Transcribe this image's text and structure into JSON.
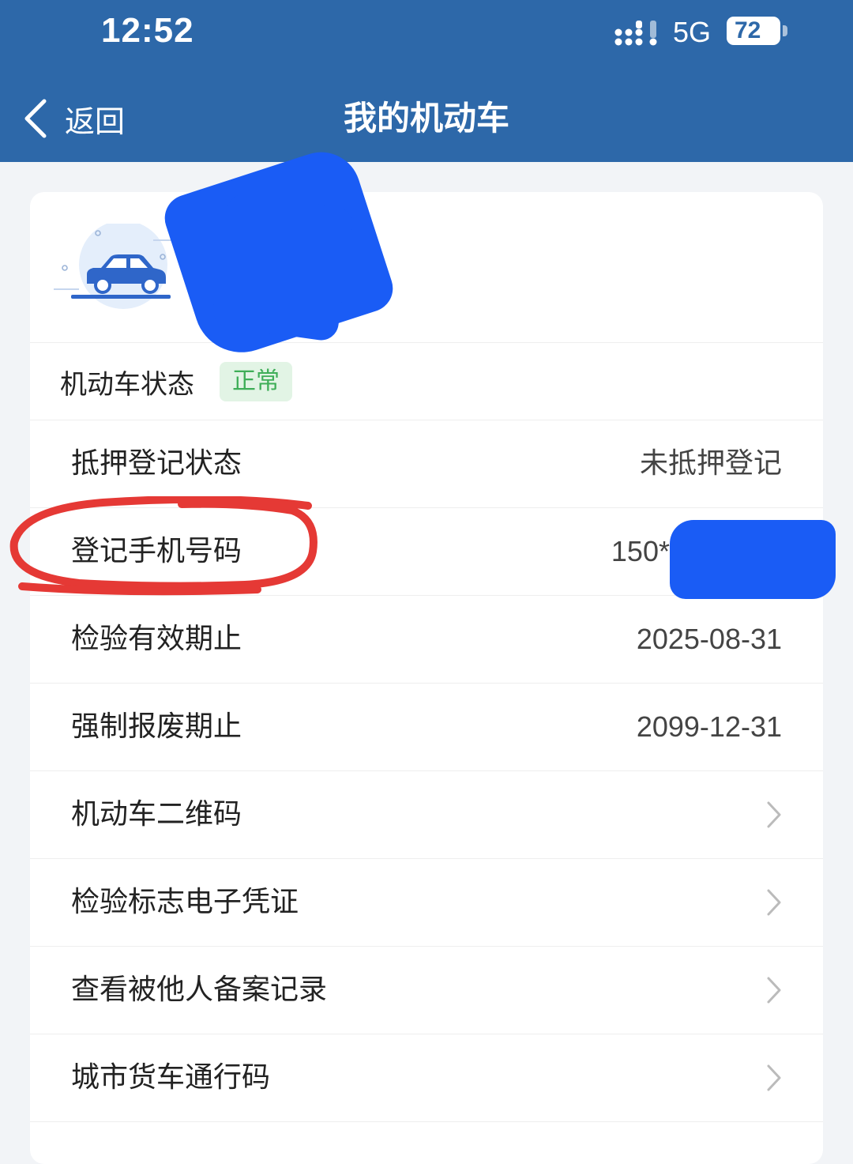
{
  "status_bar": {
    "time": "12:52",
    "network": "5G",
    "battery": "72"
  },
  "nav": {
    "back_label": "返回",
    "title": "我的机动车"
  },
  "vehicle": {
    "status_label": "机动车状态",
    "status_value": "正常"
  },
  "rows": [
    {
      "label": "抵押登记状态",
      "value": "未抵押登记"
    },
    {
      "label": "登记手机号码",
      "value": "150**"
    },
    {
      "label": "检验有效期止",
      "value": "2025-08-31"
    },
    {
      "label": "强制报废期止",
      "value": "2099-12-31"
    },
    {
      "label": "机动车二维码"
    },
    {
      "label": "检验标志电子凭证"
    },
    {
      "label": "查看被他人备案记录"
    },
    {
      "label": "城市货车通行码"
    }
  ],
  "colors": {
    "header": "#2d68a9",
    "status_badge_bg": "#e2f4e5",
    "status_badge_text": "#3fae58",
    "redaction": "#1a5cf5",
    "annotation": "#e53935"
  }
}
